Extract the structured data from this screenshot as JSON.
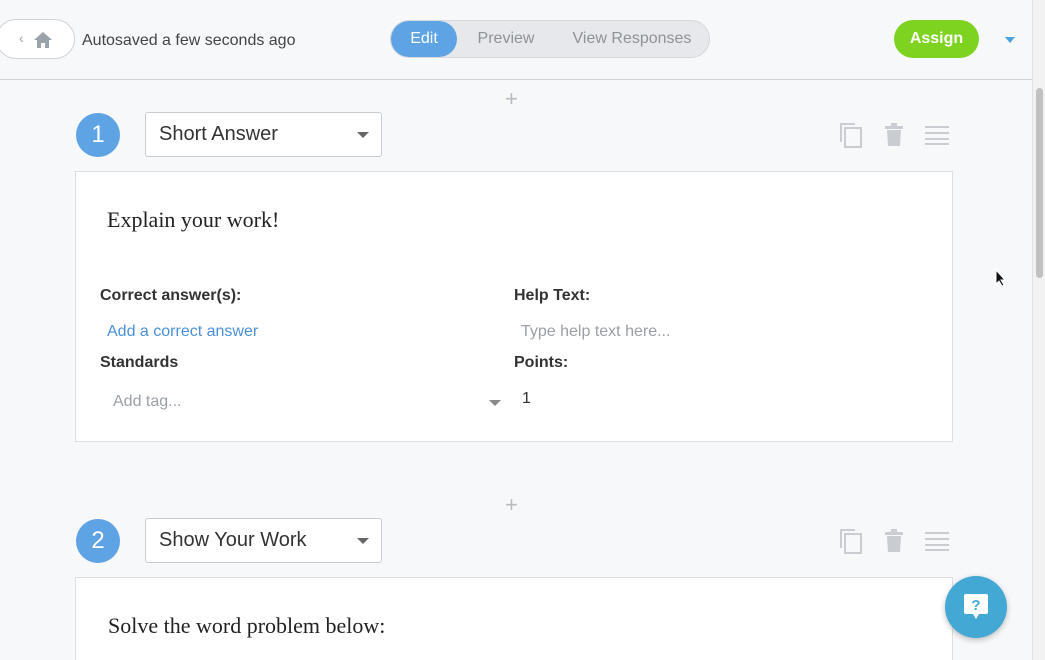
{
  "header": {
    "autosave": "Autosaved a few seconds ago",
    "tabs": [
      {
        "label": "Edit",
        "active": true
      },
      {
        "label": "Preview",
        "active": false
      },
      {
        "label": "View Responses",
        "active": false
      }
    ],
    "assign_label": "Assign",
    "icons": {
      "home": "home-icon",
      "back": "chevron-left-icon",
      "more": "caret-down-icon"
    }
  },
  "questions": [
    {
      "number": "1",
      "type": "Short Answer",
      "prompt": "Explain your work!",
      "correct_answers_label": "Correct answer(s):",
      "add_correct_answer": "Add a correct answer",
      "help_text_label": "Help Text:",
      "help_text_placeholder": "Type help text here...",
      "standards_label": "Standards",
      "tag_placeholder": "Add tag...",
      "points_label": "Points:",
      "points_value": "1"
    },
    {
      "number": "2",
      "type": "Show Your Work",
      "prompt": "Solve the word problem below:"
    }
  ],
  "toolbar_icons": [
    "copy-icon",
    "trash-icon",
    "drag-handle-icon"
  ],
  "colors": {
    "accent": "#5ea3e4",
    "assign": "#7ed321",
    "link": "#4a90d9",
    "fab": "#43a9d4"
  }
}
